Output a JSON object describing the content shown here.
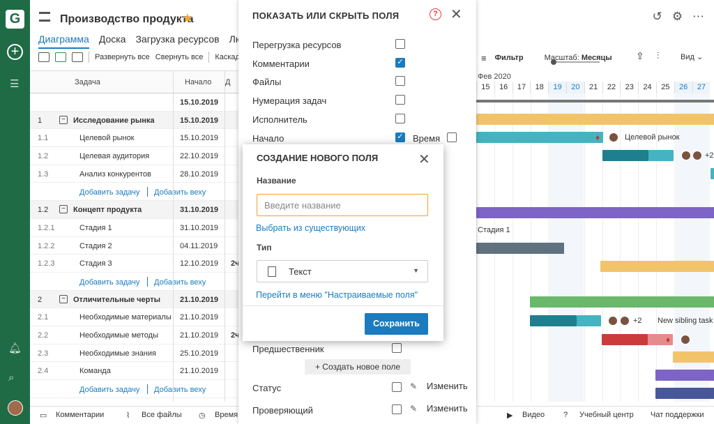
{
  "app": {
    "title": "Производство продукта",
    "tabs": [
      "Диаграмма",
      "Доска",
      "Загрузка ресурсов",
      "Люди"
    ],
    "colors": {
      "accent": "#1a7bbf",
      "brand": "#1f6b46",
      "warning": "#f0a030"
    }
  },
  "toolbar": {
    "expand_all": "Развернуть все",
    "collapse_all": "Свернуть все",
    "cascade": "Каскадн",
    "filter": "Фильтр",
    "scale_label": "Масштаб:",
    "scale_value": "Месяцы",
    "view": "Вид"
  },
  "grid": {
    "headers": {
      "task": "Задача",
      "start": "Начало",
      "dur": "Д"
    },
    "rows": [
      {
        "type": "total",
        "num": "",
        "name": "",
        "date": "15.10.2019",
        "dur": ""
      },
      {
        "type": "group",
        "num": "1",
        "name": "Исследование рынка",
        "date": "15.10.2019",
        "dur": ""
      },
      {
        "type": "task",
        "num": "1.1",
        "name": "Целевой рынок",
        "date": "15.10.2019",
        "dur": ""
      },
      {
        "type": "task",
        "num": "1.2",
        "name": "Целевая аудитория",
        "date": "22.10.2019",
        "dur": ""
      },
      {
        "type": "task",
        "num": "1.3",
        "name": "Анализ конкурентов",
        "date": "28.10.2019",
        "dur": ""
      },
      {
        "type": "add",
        "add_task": "Добавить задачу",
        "add_milestone": "Добавить веху"
      },
      {
        "type": "group",
        "num": "1.2",
        "name": "Концепт продукта",
        "date": "31.10.2019",
        "dur": ""
      },
      {
        "type": "task",
        "num": "1.2.1",
        "name": "Стадия 1",
        "date": "31.10.2019",
        "dur": ""
      },
      {
        "type": "task",
        "num": "1.2.2",
        "name": "Стадия 2",
        "date": "04.11.2019",
        "dur": ""
      },
      {
        "type": "task",
        "num": "1.2.3",
        "name": "Стадия 3",
        "date": "12.10.2019",
        "dur": "2ч"
      },
      {
        "type": "add",
        "add_task": "Добавить задачу",
        "add_milestone": "Добавить веху"
      },
      {
        "type": "group",
        "num": "2",
        "name": "Отличительные черты",
        "date": "21.10.2019",
        "dur": ""
      },
      {
        "type": "task",
        "num": "2.1",
        "name": "Необходимые материалы",
        "date": "21.10.2019",
        "dur": ""
      },
      {
        "type": "task",
        "num": "2.2",
        "name": "Необходимые методы",
        "date": "21.10.2019",
        "dur": "2ч"
      },
      {
        "type": "task",
        "num": "2.3",
        "name": "Необходимые знания",
        "date": "25.10.2019",
        "dur": ""
      },
      {
        "type": "task",
        "num": "2.4",
        "name": "Команда",
        "date": "21.10.2019",
        "dur": ""
      },
      {
        "type": "add",
        "add_task": "Добавить задачу",
        "add_milestone": "Добавить веху"
      }
    ]
  },
  "gantt": {
    "month": "Фев 2020",
    "days": [
      "15",
      "16",
      "17",
      "18",
      "19",
      "20",
      "21",
      "22",
      "23",
      "24",
      "25",
      "26",
      "27"
    ],
    "weekend_days": [
      "19",
      "20",
      "26",
      "27"
    ],
    "labels": {
      "target_market": "Целевой рынок",
      "stage1": "Стадия 1",
      "sibling": "New sibling task",
      "plus2a": "+2",
      "plus2b": "+2"
    }
  },
  "bottombar": {
    "comments": "Комментарии",
    "files": "Все файлы",
    "time": "Время",
    "video": "Видео",
    "learning": "Учебный центр",
    "support": "Чат поддержки"
  },
  "fields_panel": {
    "title": "ПОКАЗАТЬ ИЛИ СКРЫТЬ ПОЛЯ",
    "fields": [
      {
        "label": "Перегрузка ресурсов",
        "checked": false
      },
      {
        "label": "Комментарии",
        "checked": true
      },
      {
        "label": "Файлы",
        "checked": false
      },
      {
        "label": "Нумерация задач",
        "checked": false
      },
      {
        "label": "Исполнитель",
        "checked": false
      },
      {
        "label": "Начало",
        "checked": true
      }
    ],
    "time_label": "Время",
    "predecessor": "Предшественник",
    "create_new_field": "+ Создать новое поле",
    "status": "Статус",
    "reviewer": "Проверяющий",
    "edit": "Изменить"
  },
  "modal": {
    "title": "СОЗДАНИЕ НОВОГО ПОЛЯ",
    "name_label": "Название",
    "name_placeholder": "Введите название",
    "choose_existing": "Выбрать из существующих",
    "type_label": "Тип",
    "type_value": "Текст",
    "custom_fields_link": "Перейти в меню \"Настраиваемые поля\"",
    "save": "Сохранить"
  }
}
